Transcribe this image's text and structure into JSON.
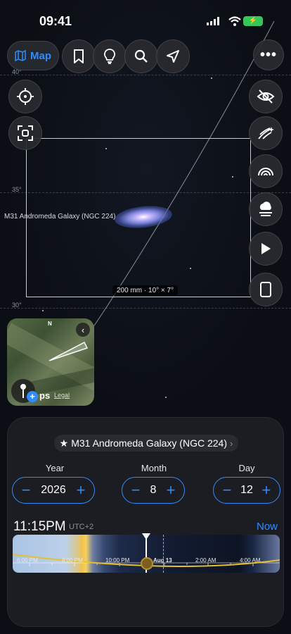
{
  "status_bar": {
    "time": "09:41"
  },
  "toolbar": {
    "map_label": "Map"
  },
  "sky": {
    "dec_labels": [
      "40°",
      "35°",
      "30°"
    ],
    "object_label": "M31 Andromeda Galaxy (NGC 224)",
    "fov_label": "200 mm · 10° × 7°"
  },
  "minimap": {
    "north": "N",
    "maps_text": "ps",
    "legal": "Legal"
  },
  "panel": {
    "target": "M31 Andromeda Galaxy (NGC 224)",
    "year_label": "Year",
    "year_value": "2026",
    "month_label": "Month",
    "month_value": "8",
    "day_label": "Day",
    "day_value": "12",
    "time": "11:15PM",
    "timezone": "UTC+2",
    "now_label": "Now",
    "timeline_ticks": [
      "6:00 PM",
      "8:00 PM",
      "10:00 PM",
      "Aug 13",
      "2:00 AM",
      "4:00 AM"
    ]
  },
  "colors": {
    "accent": "#2f8cff",
    "sun_band": "#f0c34a"
  }
}
